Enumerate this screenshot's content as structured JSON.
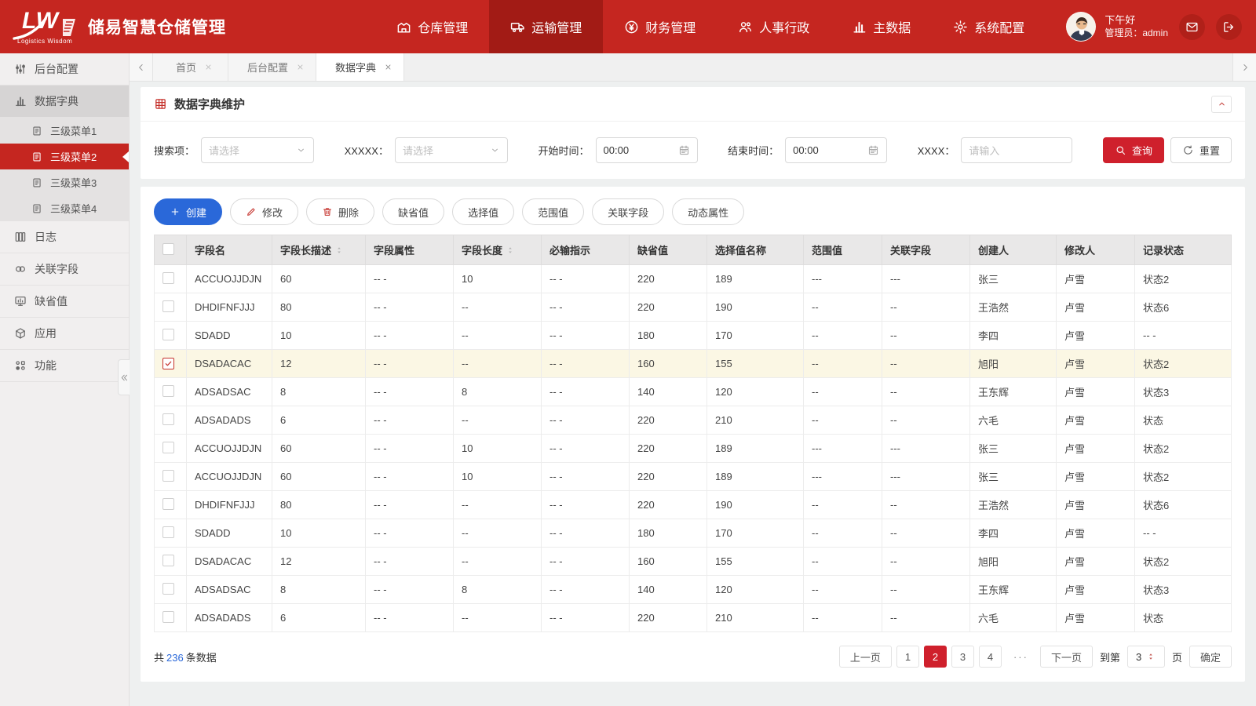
{
  "colors": {
    "brand_red": "#c52620",
    "nav_active_red": "#a21b15",
    "accent_blue": "#2a68d9",
    "query_red": "#cf202c",
    "row_highlight": "#fbf7e4",
    "count_blue": "#2a68d9"
  },
  "header": {
    "logo_lw": "LW",
    "logo_subtitle": "Logistics Wisdom",
    "app_title": "储易智慧仓储管理",
    "nav": [
      {
        "label": "仓库管理",
        "icon": "warehouse-icon",
        "active": false
      },
      {
        "label": "运输管理",
        "icon": "truck-icon",
        "active": true
      },
      {
        "label": "财务管理",
        "icon": "finance-icon",
        "active": false
      },
      {
        "label": "人事行政",
        "icon": "hr-icon",
        "active": false
      },
      {
        "label": "主数据",
        "icon": "master-data-icon",
        "active": false
      },
      {
        "label": "系统配置",
        "icon": "system-config-icon",
        "active": false
      }
    ],
    "greeting": "下午好",
    "user_role": "管理员：admin",
    "action_icons": [
      "mail-icon",
      "logout-icon"
    ]
  },
  "sidebar": {
    "items": [
      {
        "label": "后台配置",
        "icon": "settings-sliders-icon",
        "type": "top"
      },
      {
        "label": "数据字典",
        "icon": "data-dictionary-icon",
        "type": "top",
        "open": true
      },
      {
        "label": "三级菜单1",
        "icon": "document-icon",
        "type": "sub"
      },
      {
        "label": "三级菜单2",
        "icon": "document-icon",
        "type": "sub",
        "active": true
      },
      {
        "label": "三级菜单3",
        "icon": "document-icon",
        "type": "sub"
      },
      {
        "label": "三级菜单4",
        "icon": "document-icon",
        "type": "sub"
      },
      {
        "label": "日志",
        "icon": "log-icon",
        "type": "top"
      },
      {
        "label": "关联字段",
        "icon": "link-icon",
        "type": "top"
      },
      {
        "label": "缺省值",
        "icon": "default-value-icon",
        "type": "top"
      },
      {
        "label": "应用",
        "icon": "app-cube-icon",
        "type": "top"
      },
      {
        "label": "功能",
        "icon": "function-icon",
        "type": "top"
      }
    ]
  },
  "tabs": [
    {
      "label": "首页",
      "active": false
    },
    {
      "label": "后台配置",
      "active": false
    },
    {
      "label": "数据字典",
      "active": true
    }
  ],
  "panel": {
    "title": "数据字典维护",
    "icon": "table-grid-icon"
  },
  "filters": {
    "search_item_label": "搜索项：",
    "search_item_placeholder": "请选择",
    "xxxxx_label": "XXXXX：",
    "xxxxx_placeholder": "请选择",
    "start_time_label": "开始时间：",
    "start_time_value": "00:00",
    "end_time_label": "结束时间：",
    "end_time_value": "00:00",
    "xxxx_label": "XXXX：",
    "xxxx_placeholder": "请输入",
    "query_label": "查询",
    "reset_label": "重置"
  },
  "actions": [
    {
      "label": "创建",
      "icon": "plus-icon",
      "style": "primary"
    },
    {
      "label": "修改",
      "icon": "pencil-icon",
      "style": "default"
    },
    {
      "label": "删除",
      "icon": "trash-icon",
      "style": "default"
    },
    {
      "label": "缺省值",
      "style": "default"
    },
    {
      "label": "选择值",
      "style": "default"
    },
    {
      "label": "范围值",
      "style": "default"
    },
    {
      "label": "关联字段",
      "style": "default"
    },
    {
      "label": "动态属性",
      "style": "default"
    }
  ],
  "table": {
    "columns": [
      "字段名",
      "字段长描述",
      "字段属性",
      "字段长度",
      "必输指示",
      "缺省值",
      "选择值名称",
      "范围值",
      "关联字段",
      "创建人",
      "修改人",
      "记录状态"
    ],
    "sortable_column_indexes": [
      1,
      3
    ],
    "rows": [
      {
        "checked": false,
        "cells": [
          "ACCUOJJDJN",
          "60",
          "-- -",
          "10",
          "-- -",
          "220",
          "189",
          "---",
          "---",
          "张三",
          "卢雪",
          "状态2"
        ]
      },
      {
        "checked": false,
        "cells": [
          "DHDIFNFJJJ",
          "80",
          "-- -",
          "--",
          "-- -",
          "220",
          "190",
          "--",
          "--",
          "王浩然",
          "卢雪",
          "状态6"
        ]
      },
      {
        "checked": false,
        "cells": [
          "SDADD",
          "10",
          "-- -",
          "--",
          "-- -",
          "180",
          "170",
          "--",
          "--",
          "李四",
          "卢雪",
          "-- -"
        ]
      },
      {
        "checked": true,
        "cells": [
          "DSADACAC",
          "12",
          "-- -",
          "--",
          "-- -",
          "160",
          "155",
          "--",
          "--",
          "旭阳",
          "卢雪",
          "状态2"
        ]
      },
      {
        "checked": false,
        "cells": [
          "ADSADSAC",
          "8",
          "-- -",
          "8",
          "-- -",
          "140",
          "120",
          "--",
          "--",
          "王东辉",
          "卢雪",
          "状态3"
        ]
      },
      {
        "checked": false,
        "cells": [
          "ADSADADS",
          "6",
          "-- -",
          "--",
          "-- -",
          "220",
          "210",
          "--",
          "--",
          "六毛",
          "卢雪",
          "状态"
        ]
      },
      {
        "checked": false,
        "cells": [
          "ACCUOJJDJN",
          "60",
          "-- -",
          "10",
          "-- -",
          "220",
          "189",
          "---",
          "---",
          "张三",
          "卢雪",
          "状态2"
        ]
      },
      {
        "checked": false,
        "cells": [
          "ACCUOJJDJN",
          "60",
          "-- -",
          "10",
          "-- -",
          "220",
          "189",
          "---",
          "---",
          "张三",
          "卢雪",
          "状态2"
        ]
      },
      {
        "checked": false,
        "cells": [
          "DHDIFNFJJJ",
          "80",
          "-- -",
          "--",
          "-- -",
          "220",
          "190",
          "--",
          "--",
          "王浩然",
          "卢雪",
          "状态6"
        ]
      },
      {
        "checked": false,
        "cells": [
          "SDADD",
          "10",
          "-- -",
          "--",
          "-- -",
          "180",
          "170",
          "--",
          "--",
          "李四",
          "卢雪",
          "-- -"
        ]
      },
      {
        "checked": false,
        "cells": [
          "DSADACAC",
          "12",
          "-- -",
          "--",
          "-- -",
          "160",
          "155",
          "--",
          "--",
          "旭阳",
          "卢雪",
          "状态2"
        ]
      },
      {
        "checked": false,
        "cells": [
          "ADSADSAC",
          "8",
          "-- -",
          "8",
          "-- -",
          "140",
          "120",
          "--",
          "--",
          "王东辉",
          "卢雪",
          "状态3"
        ]
      },
      {
        "checked": false,
        "cells": [
          "ADSADADS",
          "6",
          "-- -",
          "--",
          "-- -",
          "220",
          "210",
          "--",
          "--",
          "六毛",
          "卢雪",
          "状态"
        ]
      }
    ]
  },
  "pagination": {
    "total_prefix": "共",
    "total_count": "236",
    "total_suffix": "条数据",
    "prev_label": "上一页",
    "next_label": "下一页",
    "pages": [
      "1",
      "2",
      "3",
      "4"
    ],
    "active_page": "2",
    "ellipsis": "···",
    "goto_prefix": "到第",
    "goto_value": "3",
    "goto_suffix": "页",
    "confirm_label": "确定"
  }
}
